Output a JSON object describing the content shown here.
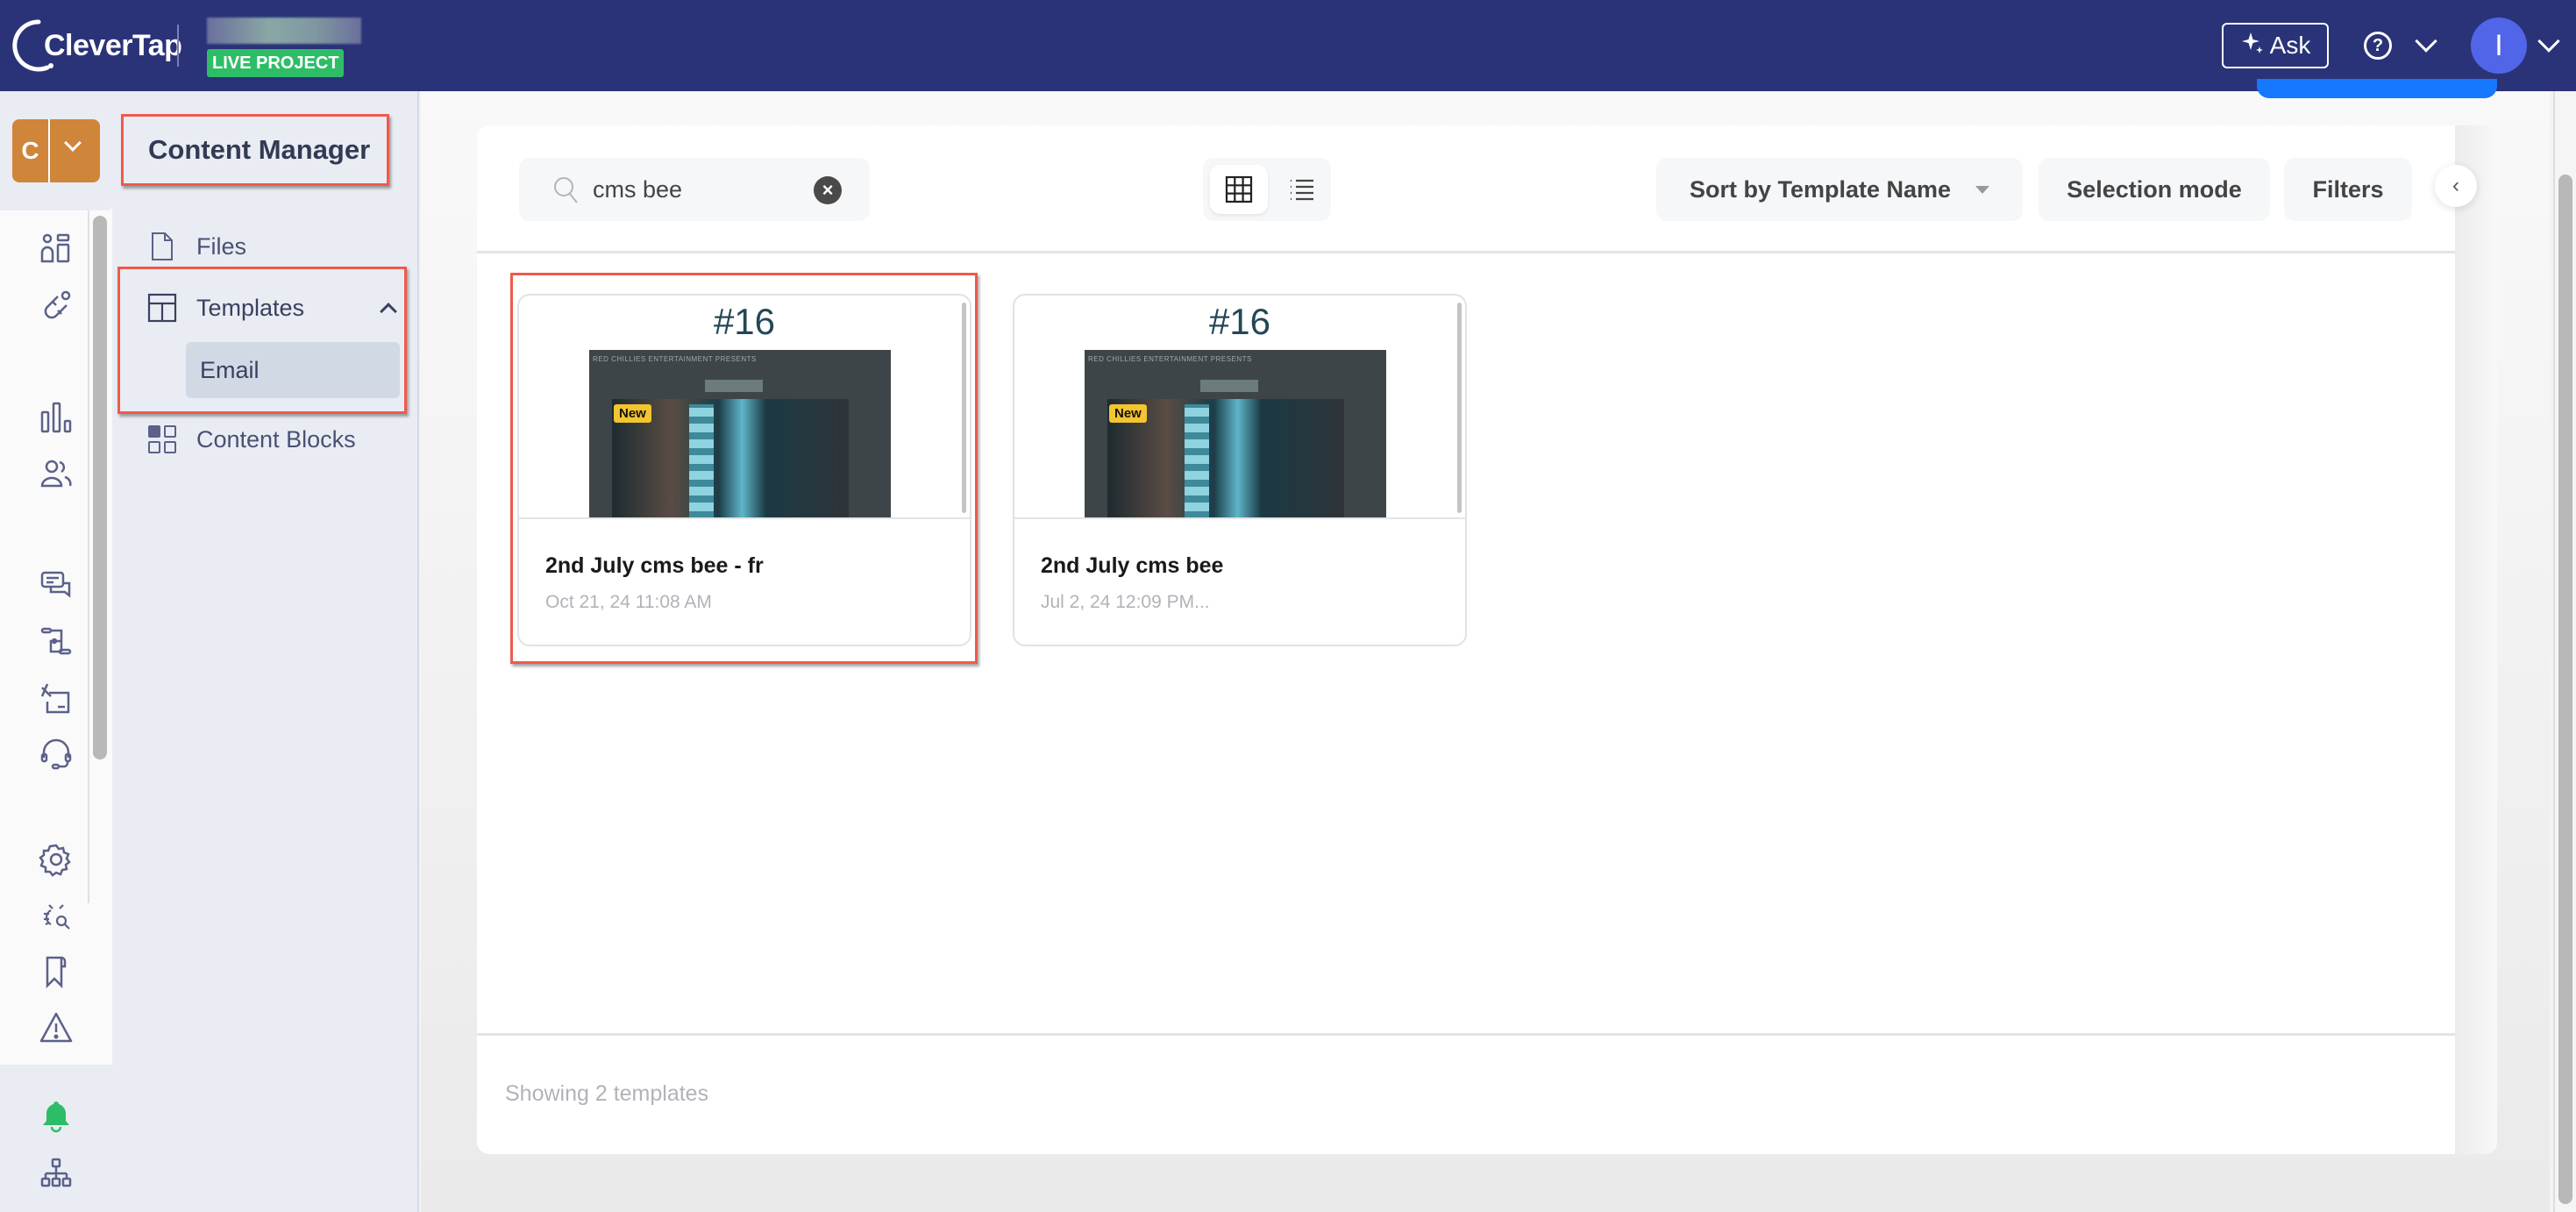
{
  "header": {
    "brand": "CleverTap",
    "project_badge": "LIVE PROJECT",
    "ask_label": "Ask",
    "help_glyph": "?",
    "avatar_initial": "I",
    "colors": {
      "header_bg": "#2a3378",
      "badge": "#2ebd67",
      "avatar": "#5165e8"
    }
  },
  "rail": {
    "project_initial": "C",
    "icons": [
      "dashboard-icon",
      "magnet-icon",
      "analytics-icon",
      "users-icon",
      "messages-icon",
      "journeys-icon",
      "campaign-icon",
      "support-icon",
      "settings-icon",
      "debug-icon",
      "bookmark-icon",
      "warning-icon",
      "notification-bell-icon",
      "hierarchy-icon"
    ]
  },
  "subnav": {
    "title": "Content Manager",
    "items": [
      {
        "label": "Files",
        "icon": "file-icon"
      },
      {
        "label": "Templates",
        "icon": "template-icon",
        "expanded": true,
        "children": [
          {
            "label": "Email",
            "selected": true
          }
        ]
      },
      {
        "label": "Content Blocks",
        "icon": "blocks-icon"
      }
    ]
  },
  "toolbar": {
    "search_value": "cms bee",
    "search_placeholder": "Search",
    "sort_label": "Sort by Template Name",
    "selection_label": "Selection mode",
    "filters_label": "Filters",
    "view_mode": "grid"
  },
  "cards": [
    {
      "number": "#16",
      "badge": "New",
      "thumb_caption": "RED CHILLIES ENTERTAINMENT PRESENTS",
      "title": "2nd July cms bee - fr",
      "date": "Oct 21, 24 11:08 AM",
      "highlighted": true
    },
    {
      "number": "#16",
      "badge": "New",
      "thumb_caption": "RED CHILLIES ENTERTAINMENT PRESENTS",
      "title": "2nd July cms bee",
      "date": "Jul 2, 24 12:09 PM...",
      "highlighted": false
    }
  ],
  "footer": {
    "summary": "Showing 2 templates"
  }
}
